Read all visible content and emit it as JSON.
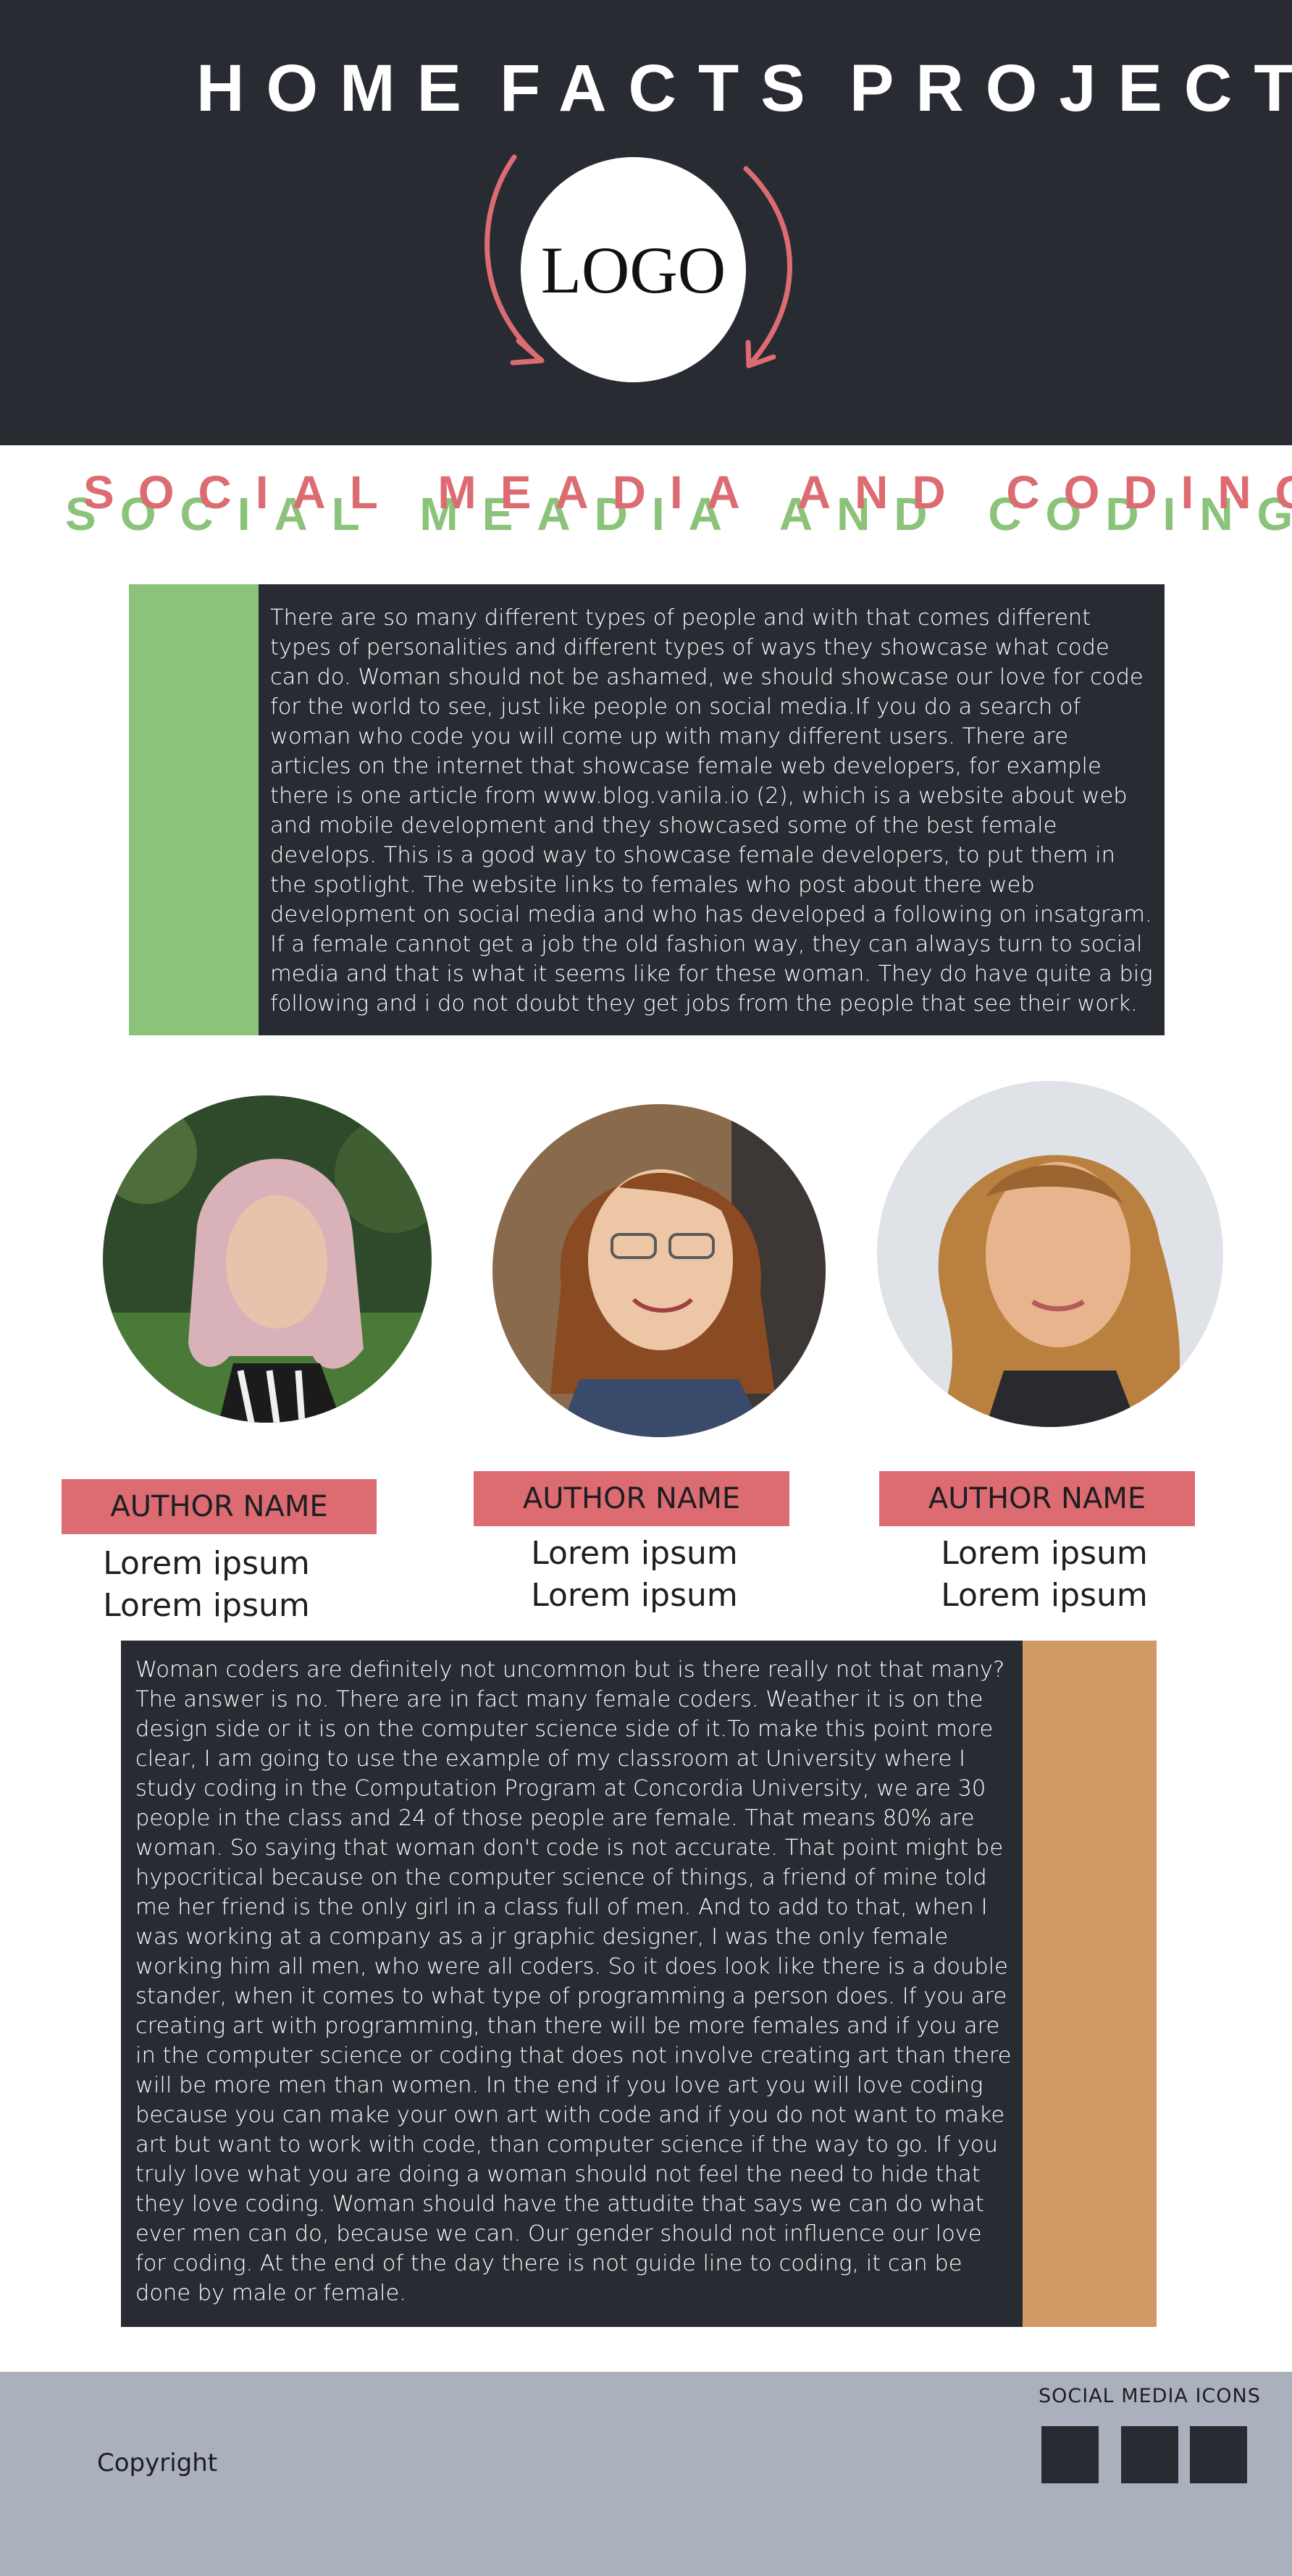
{
  "nav": {
    "home": "HOME",
    "facts": "FACTS",
    "project": "PROJECT"
  },
  "logo": {
    "text": "LOGO"
  },
  "headline": {
    "text": "SOCIAL MEADIA AND CODING"
  },
  "article1": {
    "text": "There are so many different types of people and with that comes different types of personalities and different types of ways they showcase what code can do. Woman should not be ashamed, we should showcase our love for code for the world to see, just like people on social media.If you do a search of woman who code you will come up with many different users. There are articles on the internet that showcase female web developers, for example there is one article from www.blog.vanila.io (2), which is a website about web and mobile development and they showcased some of the best female develops. This is a good way to showcase female developers, to put them in the spotlight. The website links to females who post about there web development on social media and who has developed a following on insatgram. If a female cannot get a job the old fashion way, they can always turn to social media and that is what it seems like for these woman. They do have quite a big following and i do not doubt they get jobs from the people that see their work."
  },
  "authors": [
    {
      "name": "AUTHOR NAME",
      "line1": "Lorem ipsum",
      "line2": "Lorem ipsum"
    },
    {
      "name": "AUTHOR NAME",
      "line1": "Lorem ipsum",
      "line2": "Lorem ipsum"
    },
    {
      "name": "AUTHOR NAME",
      "line1": "Lorem ipsum",
      "line2": "Lorem ipsum"
    }
  ],
  "article2": {
    "text": "Woman coders are definitely not uncommon but is there really not that many? The answer is no. There are in fact many female coders. Weather it is on the design side or it is on the computer science side of it.To make this point more clear, I am going to use the example of my classroom at University where I study coding in the Computation Program at Concordia University, we are 30 people in the class and 24 of those people are female. That means 80% are woman. So saying that woman don't code is not accurate. That point might be hypocritical because on the computer science of things, a friend of mine told me her friend is the only girl in a class full of men. And to add to that, when I was working at a company as a jr graphic designer, I was the only female working him all men, who were all coders. So it does look like there is a double stander, when it comes to what type of programming a person does. If you are creating art with programming, than there will be more females and if you are in the computer science or coding that does not involve creating art than there will be more men than women. In the end if you love art you will love coding because you can make your own art with code and if you do not want to make art but want to work with code, than computer science if the way to go. If you truly love what you are doing a woman should not feel the need to hide that they love coding. Woman should have the attudite that says we can do what ever men can do, because we can. Our gender should not influence our love for coding. At the end of the day there is not guide line to coding, it can be done by male or female."
  },
  "footer": {
    "copyright": "Copyright",
    "social_label": "SOCIAL MEDIA ICONS"
  },
  "colors": {
    "dark": "#292b33",
    "green": "#8bc37a",
    "red": "#dc6c72",
    "tan": "#d09a66",
    "footer": "#aab0bc"
  }
}
